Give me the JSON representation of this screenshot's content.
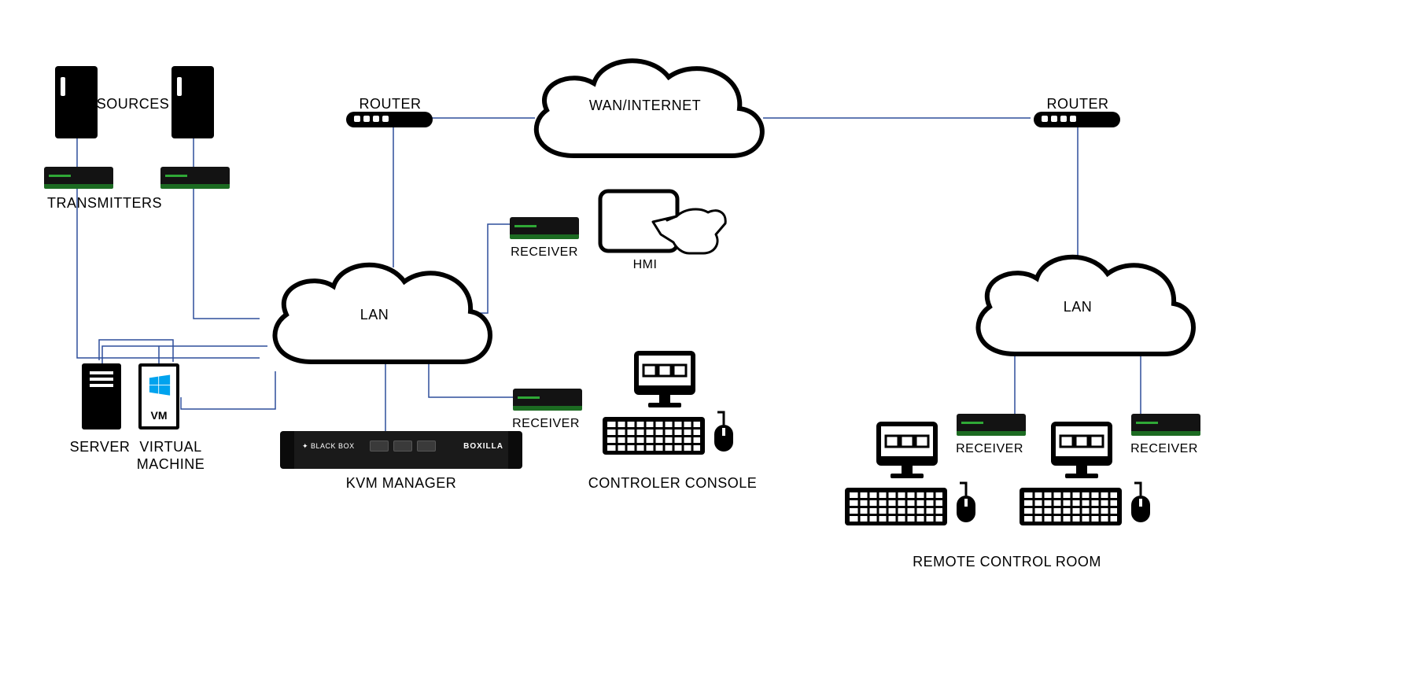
{
  "labels": {
    "sources": "SOURCES",
    "transmitters": "TRANSMITTERS",
    "router_left": "ROUTER",
    "router_right": "ROUTER",
    "wan": "WAN/INTERNET",
    "lan_left": "LAN",
    "lan_right": "LAN",
    "server": "SERVER",
    "virtual_machine": "VIRTUAL\nMACHINE",
    "virtual_machine_line1": "VIRTUAL",
    "virtual_machine_line2": "MACHINE",
    "vm_short": "VM",
    "kvm_manager": "KVM MANAGER",
    "receiver1": "RECEIVER",
    "receiver2": "RECEIVER",
    "receiver3": "RECEIVER",
    "receiver4": "RECEIVER",
    "hmi": "HMI",
    "controller_console": "CONTROLER CONSOLE",
    "remote_control_room": "REMOTE CONTROL ROOM",
    "rack_brand": "BOXILLA",
    "rack_logo": "BLACK BOX"
  },
  "diagram": {
    "nodes": [
      {
        "id": "source1",
        "type": "source-tower",
        "label_ref": "sources"
      },
      {
        "id": "source2",
        "type": "source-tower",
        "label_ref": "sources"
      },
      {
        "id": "tx1",
        "type": "transmitter",
        "label_ref": "transmitters"
      },
      {
        "id": "tx2",
        "type": "transmitter",
        "label_ref": "transmitters"
      },
      {
        "id": "server",
        "type": "server",
        "label_ref": "server"
      },
      {
        "id": "vm",
        "type": "virtual-machine",
        "label_ref": "virtual_machine"
      },
      {
        "id": "lan_left",
        "type": "cloud",
        "label_ref": "lan_left"
      },
      {
        "id": "router_left",
        "type": "router",
        "label_ref": "router_left"
      },
      {
        "id": "wan",
        "type": "cloud",
        "label_ref": "wan"
      },
      {
        "id": "router_right",
        "type": "router",
        "label_ref": "router_right"
      },
      {
        "id": "lan_right",
        "type": "cloud",
        "label_ref": "lan_right"
      },
      {
        "id": "kvm",
        "type": "kvm-manager",
        "label_ref": "kvm_manager"
      },
      {
        "id": "rx1",
        "type": "receiver",
        "label_ref": "receiver1"
      },
      {
        "id": "hmi",
        "type": "hmi-touchscreen",
        "label_ref": "hmi"
      },
      {
        "id": "rx2",
        "type": "receiver",
        "label_ref": "receiver2"
      },
      {
        "id": "console",
        "type": "workstation",
        "label_ref": "controller_console"
      },
      {
        "id": "rx3",
        "type": "receiver",
        "label_ref": "receiver3"
      },
      {
        "id": "rx4",
        "type": "receiver",
        "label_ref": "receiver4"
      },
      {
        "id": "station1",
        "type": "workstation",
        "label_ref": "remote_control_room"
      },
      {
        "id": "station2",
        "type": "workstation",
        "label_ref": "remote_control_room"
      }
    ],
    "edges": [
      [
        "source1",
        "tx1"
      ],
      [
        "source2",
        "tx2"
      ],
      [
        "tx1",
        "lan_left"
      ],
      [
        "tx2",
        "lan_left"
      ],
      [
        "server",
        "lan_left"
      ],
      [
        "vm",
        "lan_left"
      ],
      [
        "lan_left",
        "router_left"
      ],
      [
        "lan_left",
        "kvm"
      ],
      [
        "lan_left",
        "rx1"
      ],
      [
        "lan_left",
        "rx2"
      ],
      [
        "router_left",
        "wan"
      ],
      [
        "wan",
        "router_right"
      ],
      [
        "router_right",
        "lan_right"
      ],
      [
        "lan_right",
        "rx3"
      ],
      [
        "lan_right",
        "rx4"
      ]
    ]
  }
}
